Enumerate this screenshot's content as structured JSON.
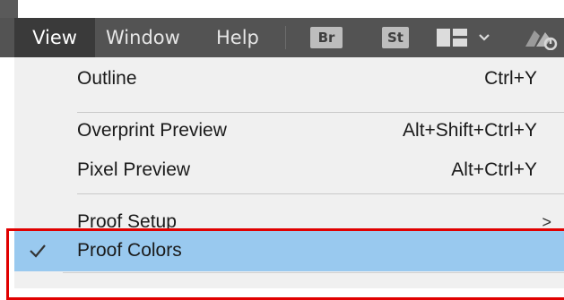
{
  "menubar": {
    "items": [
      {
        "label": "View",
        "active": true
      },
      {
        "label": "Window"
      },
      {
        "label": "Help"
      }
    ],
    "app_icons": [
      {
        "label": "Br",
        "icon": "bridge-icon"
      },
      {
        "label": "St",
        "icon": "stock-icon"
      }
    ],
    "workspace_icon": "workspace-switcher-icon",
    "cloud_icon": "cloud-sync-icon"
  },
  "dropdown": {
    "items": [
      {
        "label": "Outline",
        "shortcut": "Ctrl+Y"
      },
      {
        "label": "Overprint Preview",
        "shortcut": "Alt+Shift+Ctrl+Y"
      },
      {
        "label": "Pixel Preview",
        "shortcut": "Alt+Ctrl+Y"
      },
      {
        "label": "Proof Setup",
        "submenu_arrow": ">"
      },
      {
        "label": "Proof Colors",
        "checked": true,
        "highlighted": true
      }
    ]
  },
  "colors": {
    "menubar_bg": "#535353",
    "active_menu_bg": "#3a3a3a",
    "dropdown_bg": "#f0f0f0",
    "highlight_bg": "#99c9ef",
    "annotation_border": "#e00000"
  }
}
